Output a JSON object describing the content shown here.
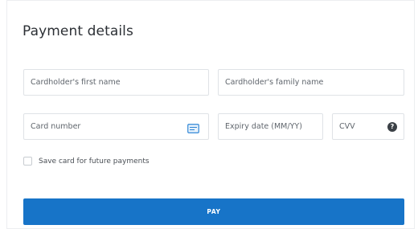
{
  "form": {
    "title": "Payment details",
    "first_name": {
      "placeholder": "Cardholder's first name",
      "value": ""
    },
    "family_name": {
      "placeholder": "Cardholder's family name",
      "value": ""
    },
    "card_number": {
      "placeholder": "Card number",
      "value": "",
      "icon": "credit-card-icon"
    },
    "expiry": {
      "placeholder": "Expiry date (MM/YY)",
      "value": ""
    },
    "cvv": {
      "placeholder": "CVV",
      "value": "",
      "icon": "help-icon",
      "help_glyph": "?"
    },
    "save_card": {
      "label": "Save card for future payments",
      "checked": false
    },
    "pay_button": {
      "label": "PAY"
    }
  },
  "colors": {
    "accent": "#1774c8",
    "border": "#dfe2e6",
    "help_icon": "#3b4046",
    "card_icon": "#2f86d6"
  }
}
